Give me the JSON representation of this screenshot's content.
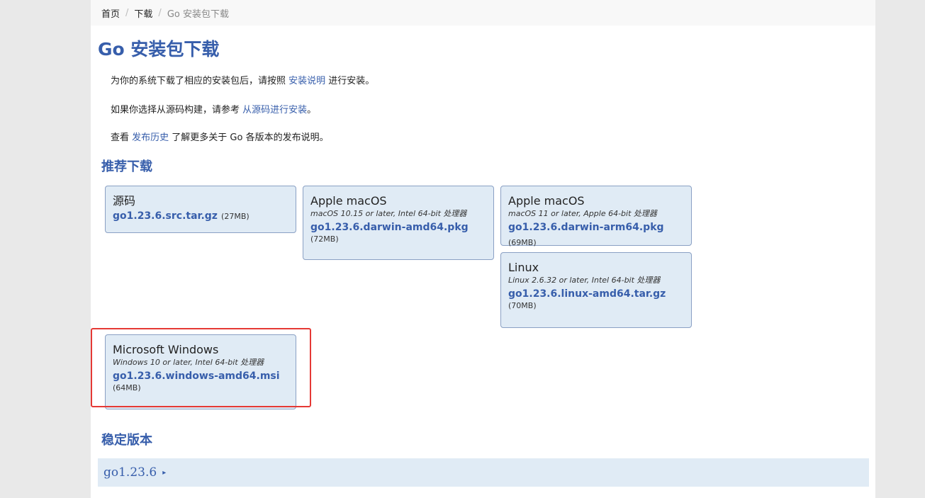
{
  "breadcrumb": {
    "home": "首页",
    "downloads": "下载",
    "current": "Go 安装包下载",
    "sep": "/"
  },
  "page_title": "Go 安装包下载",
  "intro": {
    "p1_pre": "为你的系统下载了相应的安装包后，请按照 ",
    "p1_link": "安装说明",
    "p1_post": " 进行安装。",
    "p2_pre": "如果你选择从源码构建，请参考 ",
    "p2_link": "从源码进行安装",
    "p2_post": "。",
    "p3_pre": "查看 ",
    "p3_link": "发布历史",
    "p3_post": " 了解更多关于 Go 各版本的发布说明。"
  },
  "featured_title": "推荐下载",
  "downloads": {
    "source": {
      "platform": "源码",
      "filename": "go1.23.6.src.tar.gz",
      "size": "(27MB)"
    },
    "mac_amd": {
      "platform": "Apple macOS",
      "reqs": "macOS 10.15 or later, Intel 64-bit 处理器",
      "filename": "go1.23.6.darwin-amd64.pkg",
      "size": "(72MB)"
    },
    "mac_arm": {
      "platform": "Apple macOS",
      "reqs": "macOS 11 or later, Apple 64-bit 处理器",
      "filename": "go1.23.6.darwin-arm64.pkg",
      "size": "(69MB)"
    },
    "linux": {
      "platform": "Linux",
      "reqs": "Linux 2.6.32 or later, Intel 64-bit 处理器",
      "filename": "go1.23.6.linux-amd64.tar.gz",
      "size": "(70MB)"
    },
    "windows": {
      "platform": "Microsoft Windows",
      "reqs": "Windows 10 or later, Intel 64-bit 处理器",
      "filename": "go1.23.6.windows-amd64.msi",
      "size": "(64MB)"
    }
  },
  "stable_title": "稳定版本",
  "stable_versions": [
    {
      "label": "go1.23.6",
      "arrow": "▸"
    }
  ],
  "colors": {
    "accent": "#375eab",
    "card_bg": "#e0ebf5",
    "highlight": "#e53935"
  }
}
